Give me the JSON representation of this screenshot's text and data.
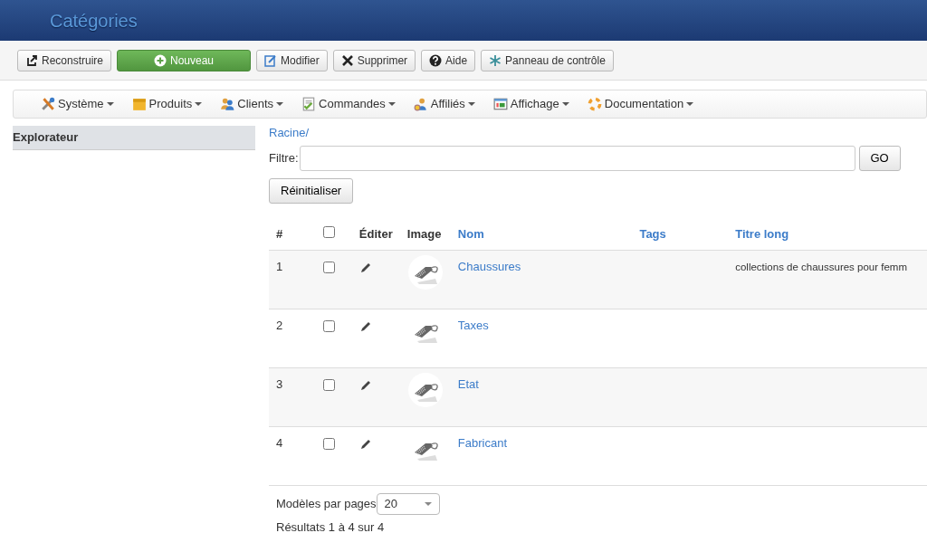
{
  "header": {
    "title": "Catégories"
  },
  "toolbar": [
    {
      "label": "Reconstruire",
      "kind": "rebuild"
    },
    {
      "label": "Nouveau",
      "kind": "new"
    },
    {
      "label": "Modifier",
      "kind": "edit"
    },
    {
      "label": "Supprimer",
      "kind": "delete"
    },
    {
      "label": "Aide",
      "kind": "help"
    },
    {
      "label": "Panneau de contrôle",
      "kind": "control"
    }
  ],
  "menu": [
    {
      "label": "Système",
      "kind": "tools"
    },
    {
      "label": "Produits",
      "kind": "box"
    },
    {
      "label": "Clients",
      "kind": "users"
    },
    {
      "label": "Commandes",
      "kind": "doc"
    },
    {
      "label": "Affiliés",
      "kind": "affiliate"
    },
    {
      "label": "Affichage",
      "kind": "display"
    },
    {
      "label": "Documentation",
      "kind": "help"
    }
  ],
  "sidebar": {
    "title": "Explorateur"
  },
  "breadcrumb": "Racine/",
  "filter": {
    "label": "Filtre:",
    "button": "GO"
  },
  "reset_button": "Réinitialiser",
  "table": {
    "columns": [
      {
        "label": "#",
        "link": false
      },
      {
        "kind": "checkbox",
        "checked": false
      },
      {
        "label": "Éditer",
        "link": false
      },
      {
        "label": "Image",
        "link": false
      },
      {
        "label": "Nom",
        "link": true
      },
      {
        "label": "Tags",
        "link": true
      },
      {
        "label": "Titre long",
        "link": true
      }
    ],
    "rows": [
      {
        "number": "1",
        "checked": false,
        "name": "Chaussures",
        "long_title": "collections de chaussures pour femm"
      },
      {
        "number": "2",
        "checked": false,
        "name": "Taxes"
      },
      {
        "number": "3",
        "checked": false,
        "name": "Etat"
      },
      {
        "number": "4",
        "checked": false,
        "name": "Fabricant"
      }
    ]
  },
  "pagination": {
    "label": "Modèles par pages",
    "per_page": "20",
    "results": "Résultats 1 à 4 sur 4"
  }
}
